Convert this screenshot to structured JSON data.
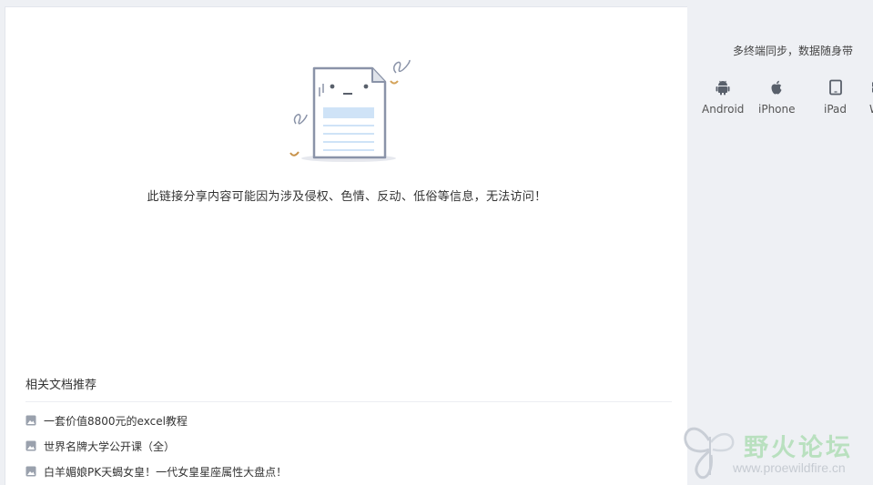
{
  "main": {
    "error_message": "此链接分享内容可能因为涉及侵权、色情、反动、低俗等信息，无法访问！",
    "recommend": {
      "title": "相关文档推荐",
      "items": [
        {
          "label": "一套价值8800元的excel教程"
        },
        {
          "label": "世界名牌大学公开课（全）"
        },
        {
          "label": "白羊媚娘PK天蝎女皇！一代女皇星座属性大盘点！"
        }
      ]
    }
  },
  "sidebar": {
    "title": "多终端同步，数据随身带",
    "devices": [
      {
        "label": "Android",
        "icon": "android-icon"
      },
      {
        "label": "iPhone",
        "icon": "apple-icon"
      },
      {
        "label": "iPad",
        "icon": "ipad-icon"
      },
      {
        "label": "WP",
        "icon": "windows-icon"
      }
    ]
  },
  "watermark": {
    "title": "野火论坛",
    "url": "www.proewildfire.cn"
  },
  "colors": {
    "background": "#eef0f4",
    "panel": "#ffffff",
    "icon": "#59606b",
    "illustration_line": "#8a93a8",
    "illustration_blue": "#cfe3f7",
    "watermark_green": "#b9e0bf"
  }
}
